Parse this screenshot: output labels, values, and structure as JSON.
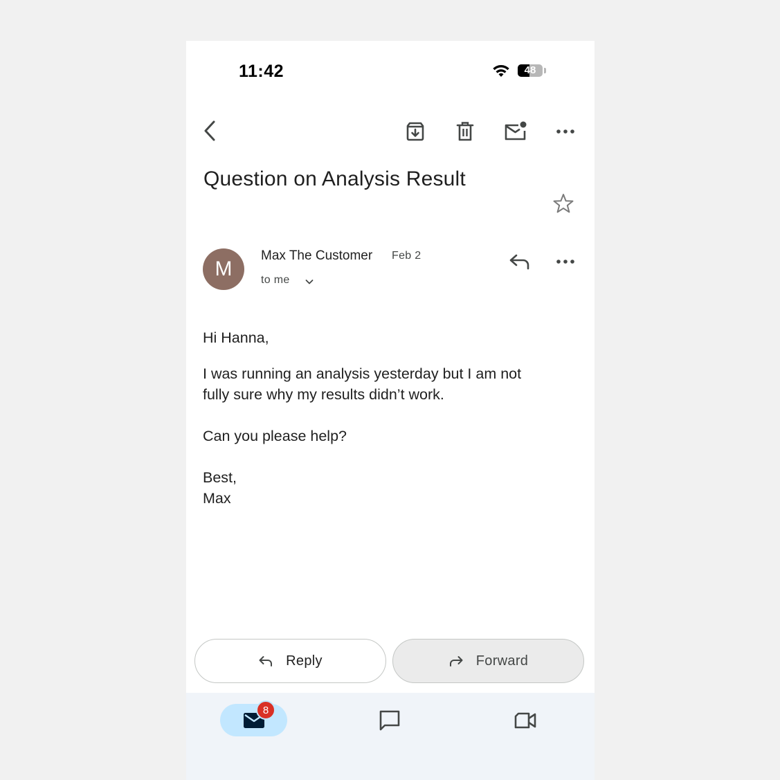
{
  "status_bar": {
    "time": "11:42",
    "battery_level": "48",
    "battery_fraction": 0.48,
    "wifi_icon": "wifi-icon"
  },
  "toolbar": {
    "back_icon": "back-arrow-icon",
    "archive_icon": "archive-icon",
    "delete_icon": "trash-icon",
    "mark_unread_icon": "mark-unread-icon",
    "more_icon": "more-horizontal-icon"
  },
  "email": {
    "subject": "Question on Analysis Result",
    "starred": false,
    "sender": {
      "initial": "M",
      "name": "Max The Customer",
      "avatar_color": "#8d6e63"
    },
    "date": "Feb 2",
    "recipient": "to me",
    "body": {
      "greeting": "Hi Hanna,",
      "paragraph1": "I was running an analysis yesterday but I am not\nfully sure why my results didn’t work.",
      "paragraph2": "Can you please help?",
      "signoff": "Best,\nMax"
    }
  },
  "actions": {
    "reply_label": "Reply",
    "forward_label": "Forward"
  },
  "bottom_nav": {
    "mail_badge": "8",
    "items": [
      "mail-icon",
      "chat-icon",
      "meet-icon"
    ],
    "accent": "#c2e7ff",
    "badge_color": "#d93025",
    "background": "#f0f4f9"
  }
}
